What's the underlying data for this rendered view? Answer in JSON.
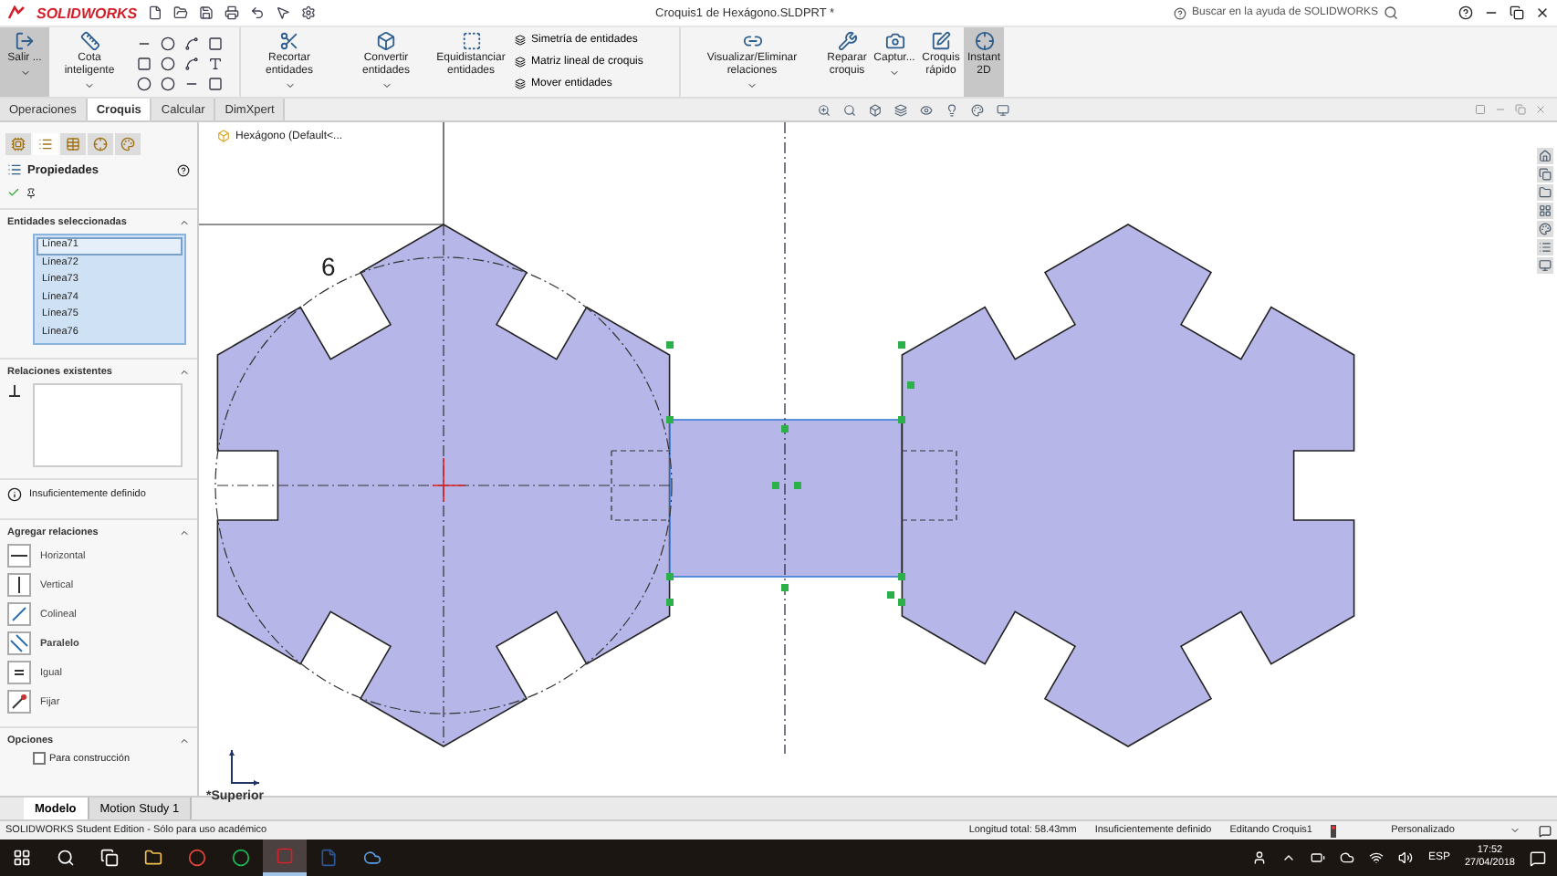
{
  "app": {
    "logo": "SOLIDWORKS",
    "title": "Croquis1 de Hexágono.SLDPRT *",
    "search_placeholder": "Buscar en la ayuda de SOLIDWORKS"
  },
  "ribbon": {
    "groups": [
      {
        "kind": "button",
        "label": "Salir ...",
        "selected": true,
        "dropdown": true
      },
      {
        "kind": "button",
        "label": "Cota inteligente",
        "selected": false,
        "dropdown": true
      },
      {
        "kind": "icons"
      },
      {
        "kind": "button",
        "label": "Recortar entidades",
        "selected": false,
        "dropdown": true
      },
      {
        "kind": "button",
        "label": "Convertir entidades",
        "selected": false,
        "dropdown": true
      },
      {
        "kind": "button",
        "label": "Equidistanciar entidades",
        "selected": false,
        "dropdown": false
      },
      {
        "kind": "list",
        "items": [
          "Simetría de entidades",
          "Matriz lineal de croquis",
          "Mover entidades"
        ]
      },
      {
        "kind": "button",
        "label": "Visualizar/Eliminar relaciones",
        "selected": false,
        "dropdown": true
      },
      {
        "kind": "button",
        "label": "Reparar croquis",
        "selected": false,
        "dropdown": false
      },
      {
        "kind": "button",
        "label": "Captur...",
        "selected": false,
        "dropdown": true
      },
      {
        "kind": "button",
        "label": "Croquis rápido",
        "selected": false,
        "dropdown": false
      },
      {
        "kind": "button",
        "label": "Instant 2D",
        "selected": true,
        "dropdown": false
      }
    ]
  },
  "command_tabs": [
    {
      "label": "Operaciones",
      "selected": false
    },
    {
      "label": "Croquis",
      "selected": true
    },
    {
      "label": "Calcular",
      "selected": false
    },
    {
      "label": "DimXpert",
      "selected": false
    }
  ],
  "panel": {
    "title": "Propiedades",
    "selected_entities": {
      "title": "Entidades seleccionadas",
      "items": [
        {
          "label": "Línea71",
          "selected": true
        },
        {
          "label": "Línea72",
          "selected": false
        },
        {
          "label": "Línea73",
          "selected": false
        },
        {
          "label": "Línea74",
          "selected": false
        },
        {
          "label": "Línea75",
          "selected": false
        },
        {
          "label": "Línea76",
          "selected": false
        }
      ]
    },
    "existing_relations": {
      "title": "Relaciones existentes"
    },
    "status": "Insuficientemente definido",
    "add_relations": {
      "title": "Agregar relaciones",
      "items": [
        {
          "label": "Horizontal",
          "kind": "horizontal",
          "selected": false
        },
        {
          "label": "Vertical",
          "kind": "vertical",
          "selected": false
        },
        {
          "label": "Colineal",
          "kind": "collinear",
          "selected": false
        },
        {
          "label": "Paralelo",
          "kind": "parallel",
          "selected": true
        },
        {
          "label": "Igual",
          "kind": "equal",
          "selected": false
        },
        {
          "label": "Fijar",
          "kind": "fix",
          "selected": false
        }
      ]
    },
    "options": {
      "title": "Opciones",
      "items": [
        {
          "label": "Para construcción",
          "checked": false
        }
      ]
    }
  },
  "canvas": {
    "tree_item": "Hexágono  (Default<...",
    "dimension": "6",
    "view_label": "*Superior"
  },
  "bottom_tabs": [
    {
      "label": "Modelo",
      "selected": true
    },
    {
      "label": "Motion Study 1",
      "selected": false
    }
  ],
  "status_bar": {
    "edition": "SOLIDWORKS Student Edition - Sólo para uso académico",
    "length": "Longitud total: 58.43mm",
    "definition": "Insuficientemente definido",
    "editing": "Editando Croquis1",
    "units": "Personalizado"
  },
  "taskbar": {
    "apps": [
      {
        "kind": "explorer",
        "selected": false
      },
      {
        "kind": "chrome",
        "selected": false
      },
      {
        "kind": "spotify",
        "selected": false
      },
      {
        "kind": "solidworks",
        "selected": true
      },
      {
        "kind": "word",
        "selected": false
      },
      {
        "kind": "onedrive",
        "selected": false
      }
    ],
    "language": "ESP",
    "time": "17:52",
    "date": "27/04/2018"
  }
}
